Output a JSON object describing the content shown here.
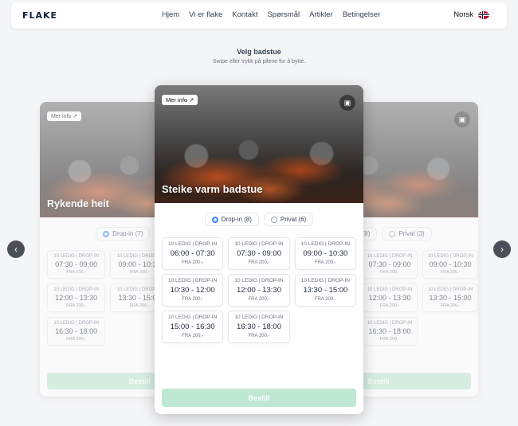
{
  "nav": {
    "logo": "FLAKE",
    "items": [
      "Hjem",
      "Vi er flake",
      "Kontakt",
      "Spørsmål",
      "Artikler",
      "Betingelser"
    ],
    "language": "Norsk"
  },
  "header": {
    "title": "Velg badstue",
    "subtitle": "Swipe eller trykk på pilene for å bytte."
  },
  "more_info_label": "Mer info ↗",
  "book_label": "Bestill",
  "cards": {
    "left": {
      "title": "Rykende heit",
      "radios": [
        "Drop-in (7)",
        "P"
      ],
      "slots": [
        {
          "label": "10 LEDIG | DROP-IN",
          "time": "07:30 - 09:00",
          "price": "FRA 200,-"
        },
        {
          "label": "10 LEDIG | DROP-IN",
          "time": "09:00 - 10:30",
          "price": "FRA 200,-"
        },
        {
          "label": "10 LEDIG | DROP-IN",
          "time": "12:00 - 13:30",
          "price": "FRA 200,-"
        },
        {
          "label": "10 LEDIG | DROP-IN",
          "time": "13:30 - 15:00",
          "price": "FRA 200,-"
        },
        {
          "label": "10 LEDIG | DROP-IN",
          "time": "16:30 - 18:00",
          "price": "FRA 200,-"
        }
      ]
    },
    "center": {
      "title": "Steike varm badstue",
      "radios": [
        "Drop-in (8)",
        "Privat (6)"
      ],
      "slots": [
        {
          "label": "10 LEDIG | DROP-IN",
          "time": "06:00 - 07:30",
          "price": "FRA 200,-"
        },
        {
          "label": "10 LEDIG | DROP-IN",
          "time": "07:30 - 09:00",
          "price": "FRA 200,-"
        },
        {
          "label": "10 LEDIG | DROP-IN",
          "time": "09:00 - 10:30",
          "price": "FRA 200,-"
        },
        {
          "label": "10 LEDIG | DROP-IN",
          "time": "10:30 - 12:00",
          "price": "FRA 200,-"
        },
        {
          "label": "10 LEDIG | DROP-IN",
          "time": "12:00 - 13:30",
          "price": "FRA 200,-"
        },
        {
          "label": "10 LEDIG | DROP-IN",
          "time": "13:30 - 15:00",
          "price": "FRA 200,-"
        },
        {
          "label": "10 LEDIG | DROP-IN",
          "time": "15:00 - 16:30",
          "price": "FRA 200,-"
        },
        {
          "label": "10 LEDIG | DROP-IN",
          "time": "16:30 - 18:00",
          "price": "FRA 200,-"
        }
      ]
    },
    "right": {
      "radios": [
        "in (8)",
        "Privat (3)"
      ],
      "slots": [
        {
          "label": "10 LEDIG | DROP-IN",
          "time": "07:30 - 09:00",
          "price": "FRA 200,-"
        },
        {
          "label": "10 LEDIG | DROP-IN",
          "time": "09:00 - 10:30",
          "price": "FRA 200,-"
        },
        {
          "label": "10 LEDIG | DROP-IN",
          "time": "12:00 - 13:30",
          "price": "FRA 200,-"
        },
        {
          "label": "10 LEDIG | DROP-IN",
          "time": "13:30 - 15:00",
          "price": "FRA 200,-"
        },
        {
          "label": "10 LEDIG | DROP-IN",
          "time": "16:30 - 18:00",
          "price": "FRA 200,-"
        }
      ]
    }
  },
  "icons": {
    "prev": "chevron-left-icon",
    "next": "chevron-right-icon",
    "map": "map-icon",
    "flag": "norway-flag-icon"
  }
}
